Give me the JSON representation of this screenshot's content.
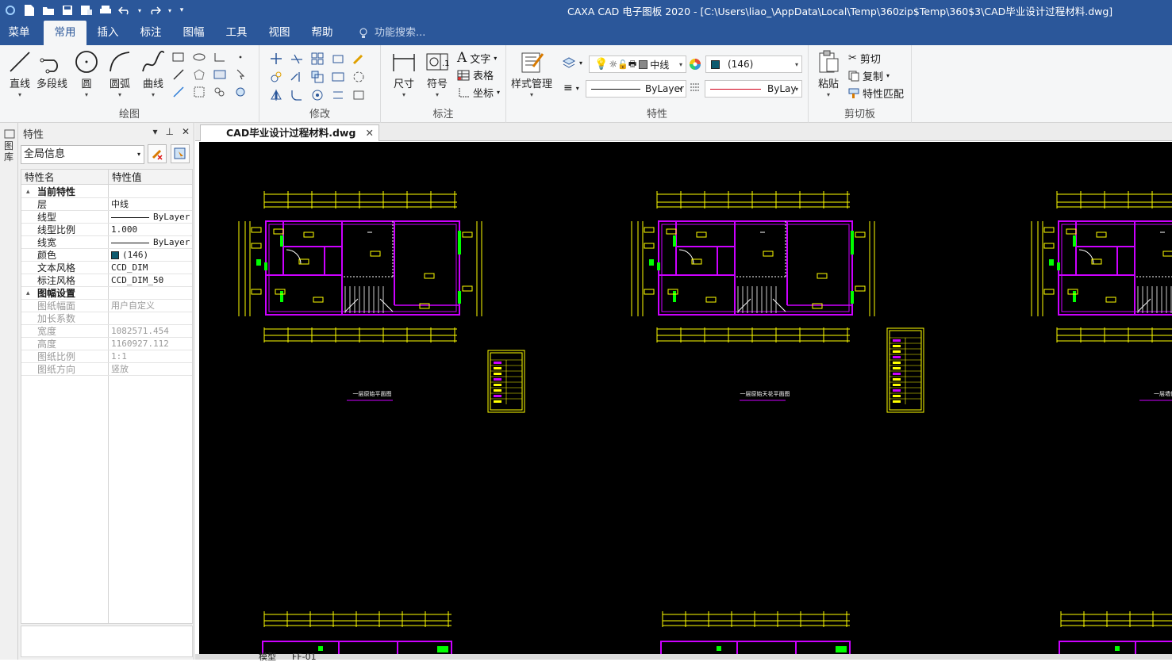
{
  "window": {
    "title": "CAXA CAD 电子图板 2020 - [C:\\Users\\liao_\\AppData\\Local\\Temp\\360zip$Temp\\360$3\\CAD毕业设计过程材料.dwg]"
  },
  "menu": {
    "tabs": [
      "菜单",
      "常用",
      "插入",
      "标注",
      "图幅",
      "工具",
      "视图",
      "帮助"
    ],
    "active": "常用",
    "search_placeholder": "功能搜索..."
  },
  "ribbon": {
    "draw": {
      "label": "绘图",
      "line": "直线",
      "polyline": "多段线",
      "circle": "圆",
      "arc": "圆弧",
      "curve": "曲线"
    },
    "modify": {
      "label": "修改"
    },
    "annotate": {
      "label": "标注",
      "dimension": "尺寸",
      "symbol": "符号",
      "text": "文字",
      "table": "表格",
      "coordinate": "坐标"
    },
    "properties": {
      "label": "特性",
      "style_manager": "样式管理",
      "layer_value": "中线",
      "color_value": "(146)",
      "linetype_value": "ByLayer",
      "lineweight_value": "ByLay",
      "layer_color": "#e8e8e8",
      "aci146_color": "#0e5a6e"
    },
    "clipboard": {
      "label": "剪切板",
      "paste": "粘贴",
      "cut": "剪切",
      "copy": "复制",
      "match": "特性匹配"
    }
  },
  "left_strip": {
    "label": "图库"
  },
  "properties_panel": {
    "title": "特性",
    "scope": "全局信息",
    "col_name": "特性名",
    "col_value": "特性值",
    "rows": [
      {
        "key": "当前特性",
        "value": "",
        "section": true
      },
      {
        "key": "层",
        "value": "中线"
      },
      {
        "key": "线型",
        "value": "ByLayer"
      },
      {
        "key": "线型比例",
        "value": "1.000"
      },
      {
        "key": "线宽",
        "value": "ByLayer"
      },
      {
        "key": "颜色",
        "value": "(146)"
      },
      {
        "key": "文本风格",
        "value": "CCD_DIM"
      },
      {
        "key": "标注风格",
        "value": "CCD_DIM_50"
      },
      {
        "key": "图幅设置",
        "value": "",
        "section": true
      },
      {
        "key": "图纸幅面",
        "value": "用户自定义",
        "disabled": true
      },
      {
        "key": "加长系数",
        "value": "",
        "disabled": true
      },
      {
        "key": "宽度",
        "value": "1082571.454",
        "disabled": true
      },
      {
        "key": "高度",
        "value": "1160927.112",
        "disabled": true
      },
      {
        "key": "图纸比例",
        "value": "1:1",
        "disabled": true
      },
      {
        "key": "图纸方向",
        "value": "竖放",
        "disabled": true
      }
    ]
  },
  "document": {
    "tab": "CAD毕业设计过程材料.dwg"
  },
  "drawing": {
    "sheet_titles": [
      "一层原始平面图",
      "一层原始天花平面图",
      "一层墙体"
    ],
    "colors": {
      "wall": "#cc00ff",
      "dim": "#ffff00",
      "green": "#00ff00",
      "white": "#ffffff"
    }
  },
  "layouts": [
    "模型",
    "FF-01"
  ]
}
